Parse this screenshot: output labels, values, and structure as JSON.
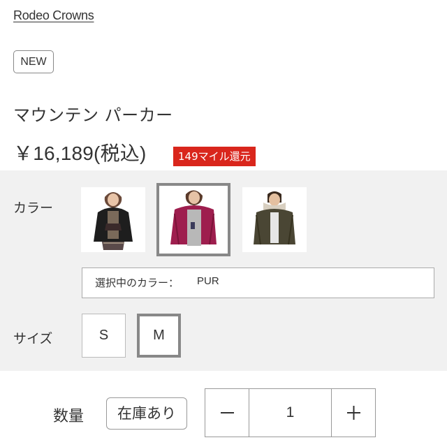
{
  "brand": "Rodeo Crowns",
  "badge_new": "NEW",
  "product_name": "マウンテン パーカー",
  "price": "￥16,189(税込)",
  "mile_badge": "149マイル還元",
  "options": {
    "color_label": "カラー",
    "selected_color_label": "選択中のカラー：",
    "selected_color_value": "PUR",
    "size_label": "サイズ",
    "sizes": [
      "S",
      "M"
    ],
    "selected_size": "M"
  },
  "quantity": {
    "label": "数量",
    "stock_status": "在庫あり",
    "value": "1",
    "minus_icon": "minus-icon",
    "plus_icon": "plus-icon"
  },
  "colors": {
    "selected_border": "#888888",
    "mile_badge_bg": "#d9261c",
    "panel_bg": "#f1f1f1"
  }
}
